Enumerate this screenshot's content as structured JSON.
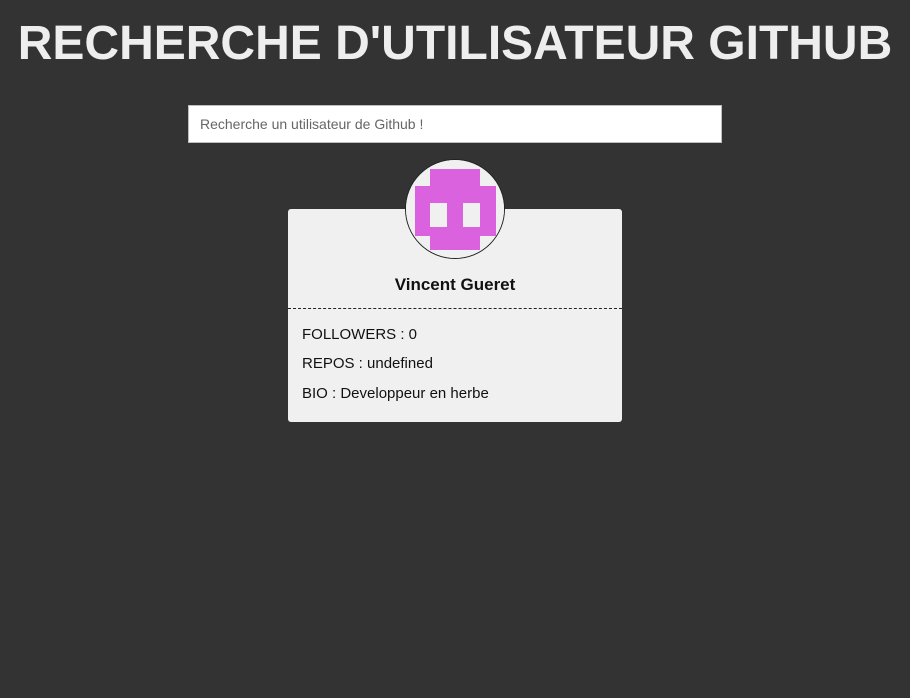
{
  "header": {
    "title": "RECHERCHE D'UTILISATEUR GITHUB"
  },
  "search": {
    "placeholder": "Recherche un utilisateur de Github !",
    "value": ""
  },
  "profile": {
    "avatar_icon": "identicon-avatar-icon",
    "avatar_color": "#da62de",
    "name": "Vincent Gueret",
    "followers_text": "FOLLOWERS : 0",
    "repos_text": "REPOS : undefined",
    "bio_text": "BIO : Developpeur en herbe"
  },
  "colors": {
    "background": "#333333",
    "card": "#f0f0f0",
    "title": "#eeeeee"
  }
}
